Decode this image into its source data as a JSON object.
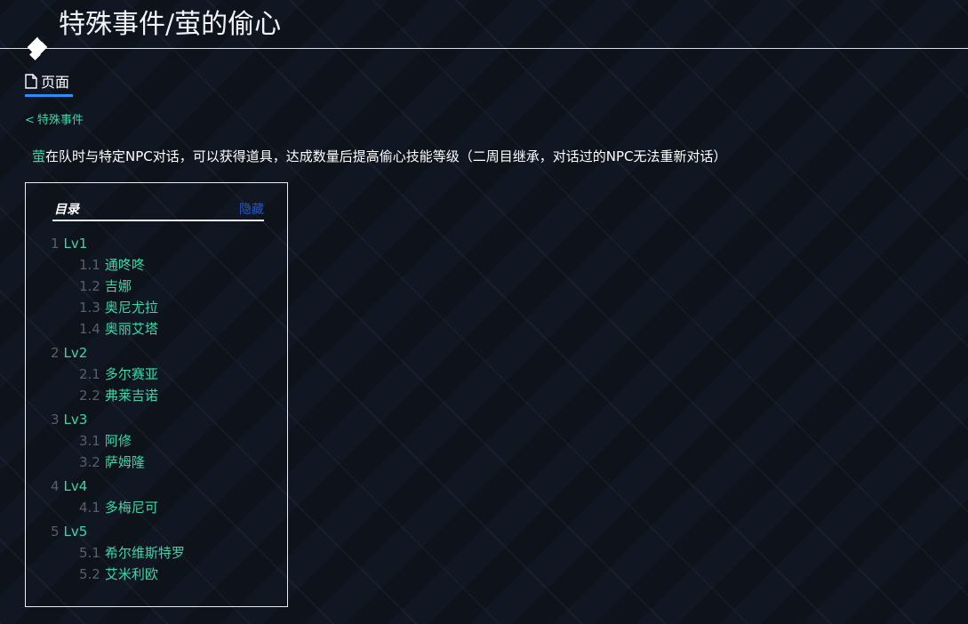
{
  "header": {
    "title": "特殊事件/萤的偷心"
  },
  "tabs": {
    "page_label": "页面"
  },
  "breadcrumb": {
    "arrow": "<",
    "label": "特殊事件"
  },
  "description": {
    "highlight": "萤",
    "text": "在队时与特定NPC对话，可以获得道具，达成数量后提高偷心技能等级（二周目继承，对话过的NPC无法重新对话）"
  },
  "toc": {
    "title": "目录",
    "hide_label": "隐藏",
    "items": [
      {
        "num": "1",
        "text": "Lv1"
      },
      {
        "num": "1.1",
        "text": "通咚咚"
      },
      {
        "num": "1.2",
        "text": "吉娜"
      },
      {
        "num": "1.3",
        "text": "奥尼尤拉"
      },
      {
        "num": "1.4",
        "text": "奥丽艾塔"
      },
      {
        "num": "2",
        "text": "Lv2"
      },
      {
        "num": "2.1",
        "text": "多尔赛亚"
      },
      {
        "num": "2.2",
        "text": "弗莱吉诺"
      },
      {
        "num": "3",
        "text": "Lv3"
      },
      {
        "num": "3.1",
        "text": "阿修"
      },
      {
        "num": "3.2",
        "text": "萨姆隆"
      },
      {
        "num": "4",
        "text": "Lv4"
      },
      {
        "num": "4.1",
        "text": "多梅尼可"
      },
      {
        "num": "5",
        "text": "Lv5"
      },
      {
        "num": "5.1",
        "text": "希尔维斯特罗"
      },
      {
        "num": "5.2",
        "text": "艾米利欧"
      }
    ]
  },
  "colors": {
    "link": "#3dd6a5",
    "accent": "#2e8df4",
    "hide_link": "#2556c9",
    "background": "#111722"
  }
}
